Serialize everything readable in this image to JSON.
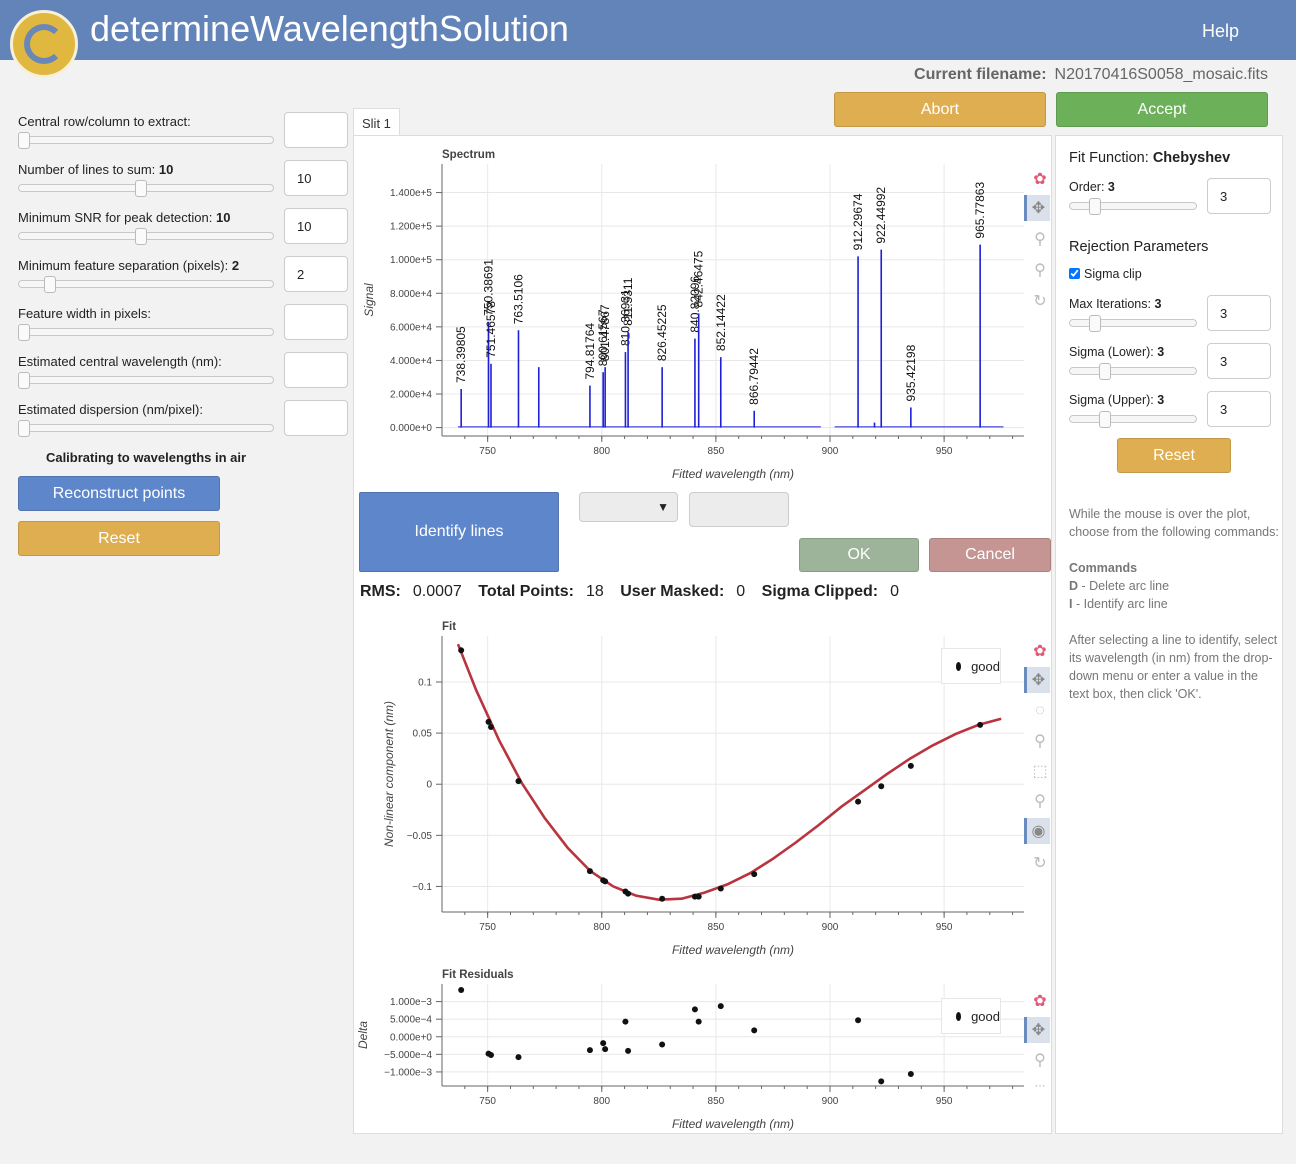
{
  "app": {
    "title": "determineWavelengthSolution",
    "help": "Help"
  },
  "file": {
    "label": "Current filename:",
    "name": "N20170416S0058_mosaic.fits"
  },
  "actions": {
    "abort": "Abort",
    "accept": "Accept"
  },
  "left": {
    "controls": [
      {
        "label": "Central row/column to extract:",
        "value_label": "",
        "input": ""
      },
      {
        "label": "Number of lines to sum:",
        "value_label": "10",
        "input": "10"
      },
      {
        "label": "Minimum SNR for peak detection:",
        "value_label": "10",
        "input": "10"
      },
      {
        "label": "Minimum feature separation (pixels):",
        "value_label": "2",
        "input": "2"
      },
      {
        "label": "Feature width in pixels:",
        "value_label": "",
        "input": ""
      },
      {
        "label": "Estimated central wavelength (nm):",
        "value_label": "",
        "input": ""
      },
      {
        "label": "Estimated dispersion (nm/pixel):",
        "value_label": "",
        "input": ""
      }
    ],
    "calibrating": "Calibrating to wavelengths in air",
    "reconstruct": "Reconstruct points",
    "reset": "Reset"
  },
  "tab": "Slit 1",
  "identify": {
    "button": "Identify lines",
    "ok": "OK",
    "cancel": "Cancel"
  },
  "stats": {
    "rms_label": "RMS:",
    "rms": "0.0007",
    "total_label": "Total Points:",
    "total": "18",
    "masked_label": "User Masked:",
    "masked": "0",
    "clipped_label": "Sigma Clipped:",
    "clipped": "0"
  },
  "right": {
    "fit_function_label": "Fit Function:",
    "fit_function": "Chebyshev",
    "order_label": "Order:",
    "order": "3",
    "rejection_title": "Rejection Parameters",
    "sigma_clip": "Sigma clip",
    "max_iter_label": "Max Iterations:",
    "max_iter": "3",
    "sigma_lower_label": "Sigma (Lower):",
    "sigma_lower": "3",
    "sigma_upper_label": "Sigma (Upper):",
    "sigma_upper": "3",
    "reset": "Reset",
    "help_intro": "While the mouse is over the plot, choose from the following commands:",
    "commands_title": "Commands",
    "cmd_d_key": "D",
    "cmd_d": " - Delete arc line",
    "cmd_i_key": "I",
    "cmd_i": " - Identify arc line",
    "help_after": "After selecting a line to identify, select its wavelength (in nm) from the drop-down menu or enter a value in the text box, then click 'OK'."
  },
  "legend": "good",
  "colors": {
    "header": "#6284b8",
    "abort": "#dfae50",
    "accept": "#6cb05a",
    "blue_btn": "#5e86cb",
    "ok": "#9db39a",
    "cancel": "#c49593",
    "spectrum": "#1f1fd6",
    "fit_line": "#b8343e"
  },
  "chart_data": [
    {
      "type": "line",
      "title": "Spectrum",
      "xlabel": "Fitted wavelength (nm)",
      "ylabel": "Signal",
      "xlim": [
        730,
        985
      ],
      "ylim": [
        -5000,
        157000
      ],
      "xticks": [
        750,
        800,
        850,
        900,
        950
      ],
      "yticks": [
        0,
        20000,
        40000,
        60000,
        80000,
        100000,
        120000,
        140000
      ],
      "ytick_labels": [
        "0.000e+0",
        "2.000e+4",
        "4.000e+4",
        "6.000e+4",
        "8.000e+4",
        "1.000e+5",
        "1.200e+5",
        "1.400e+5"
      ],
      "peaks": [
        {
          "x": 738.39805,
          "y": 23000,
          "label": "738.39805"
        },
        {
          "x": 750.38691,
          "y": 63000,
          "label": "750.38691"
        },
        {
          "x": 751.46578,
          "y": 38000,
          "label": "751.46578"
        },
        {
          "x": 763.5106,
          "y": 58000,
          "label": "763.5106"
        },
        {
          "x": 772.4,
          "y": 36000,
          "label": ""
        },
        {
          "x": 794.81764,
          "y": 25000,
          "label": "794.81764"
        },
        {
          "x": 800.61567,
          "y": 33000,
          "label": "800.61567"
        },
        {
          "x": 801.47867,
          "y": 36000,
          "label": "801.47867"
        },
        {
          "x": 810.36931,
          "y": 45000,
          "label": "810.36931"
        },
        {
          "x": 811.5311,
          "y": 57000,
          "label": "811.5311"
        },
        {
          "x": 826.45225,
          "y": 36000,
          "label": "826.45225"
        },
        {
          "x": 840.82096,
          "y": 53000,
          "label": "840.82096"
        },
        {
          "x": 842.46475,
          "y": 68000,
          "label": "842.46475"
        },
        {
          "x": 852.14422,
          "y": 42000,
          "label": "852.14422"
        },
        {
          "x": 866.79442,
          "y": 10000,
          "label": "866.79442"
        },
        {
          "x": 912.29674,
          "y": 102000,
          "label": "912.29674"
        },
        {
          "x": 919.5,
          "y": 3000,
          "label": ""
        },
        {
          "x": 922.44992,
          "y": 106000,
          "label": "922.44992"
        },
        {
          "x": 935.42198,
          "y": 12000,
          "label": "935.42198"
        },
        {
          "x": 965.77863,
          "y": 109000,
          "label": "965.77863"
        }
      ]
    },
    {
      "type": "scatter",
      "title": "Fit",
      "xlabel": "Fitted wavelength (nm)",
      "ylabel": "Non-linear component (nm)",
      "xlim": [
        730,
        985
      ],
      "ylim": [
        -0.125,
        0.145
      ],
      "xticks": [
        750,
        800,
        850,
        900,
        950
      ],
      "yticks": [
        -0.1,
        -0.05,
        0,
        0.05,
        0.1
      ],
      "ytick_labels": [
        "−0.1",
        "−0.05",
        "0",
        "0.05",
        "0.1"
      ],
      "legend": "good",
      "x": [
        738.398,
        750.387,
        751.466,
        763.511,
        794.818,
        800.616,
        801.479,
        810.369,
        811.531,
        826.452,
        840.821,
        842.465,
        852.144,
        866.794,
        912.297,
        922.45,
        935.422,
        965.779
      ],
      "y": [
        0.131,
        0.061,
        0.056,
        0.003,
        -0.085,
        -0.094,
        -0.095,
        -0.105,
        -0.107,
        -0.112,
        -0.11,
        -0.11,
        -0.102,
        -0.088,
        -0.017,
        -0.002,
        0.018,
        0.058
      ],
      "curve_x": [
        737,
        745,
        755,
        765,
        775,
        785,
        795,
        805,
        815,
        825,
        835,
        845,
        855,
        865,
        875,
        885,
        895,
        905,
        915,
        925,
        935,
        945,
        955,
        965,
        975
      ],
      "curve_y": [
        0.137,
        0.092,
        0.043,
        0.001,
        -0.033,
        -0.062,
        -0.085,
        -0.1,
        -0.109,
        -0.113,
        -0.112,
        -0.106,
        -0.098,
        -0.087,
        -0.073,
        -0.057,
        -0.04,
        -0.022,
        -0.006,
        0.01,
        0.025,
        0.038,
        0.049,
        0.058,
        0.064
      ]
    },
    {
      "type": "scatter",
      "title": "Fit Residuals",
      "xlabel": "Fitted wavelength (nm)",
      "ylabel": "Delta",
      "xlim": [
        730,
        985
      ],
      "ylim": [
        -0.0014,
        0.0015
      ],
      "xticks": [
        750,
        800,
        850,
        900,
        950
      ],
      "yticks": [
        -0.001,
        -0.0005,
        0,
        0.0005,
        0.001
      ],
      "ytick_labels": [
        "−1.000e−3",
        "−5.000e−4",
        "0.000e+0",
        "5.000e−4",
        "1.000e−3"
      ],
      "legend": "good",
      "x": [
        738.398,
        750.387,
        751.466,
        763.511,
        794.818,
        800.616,
        801.479,
        810.369,
        811.531,
        826.452,
        840.821,
        842.465,
        852.144,
        866.794,
        912.297,
        922.45,
        935.422,
        965.779
      ],
      "y": [
        0.00133,
        -0.00048,
        -0.00052,
        -0.00058,
        -0.00038,
        -0.00018,
        -0.00035,
        0.00043,
        -0.0004,
        -0.00022,
        0.00078,
        0.00043,
        0.00087,
        0.00018,
        0.00047,
        -0.00127,
        -0.00106,
        0.00095
      ]
    }
  ]
}
